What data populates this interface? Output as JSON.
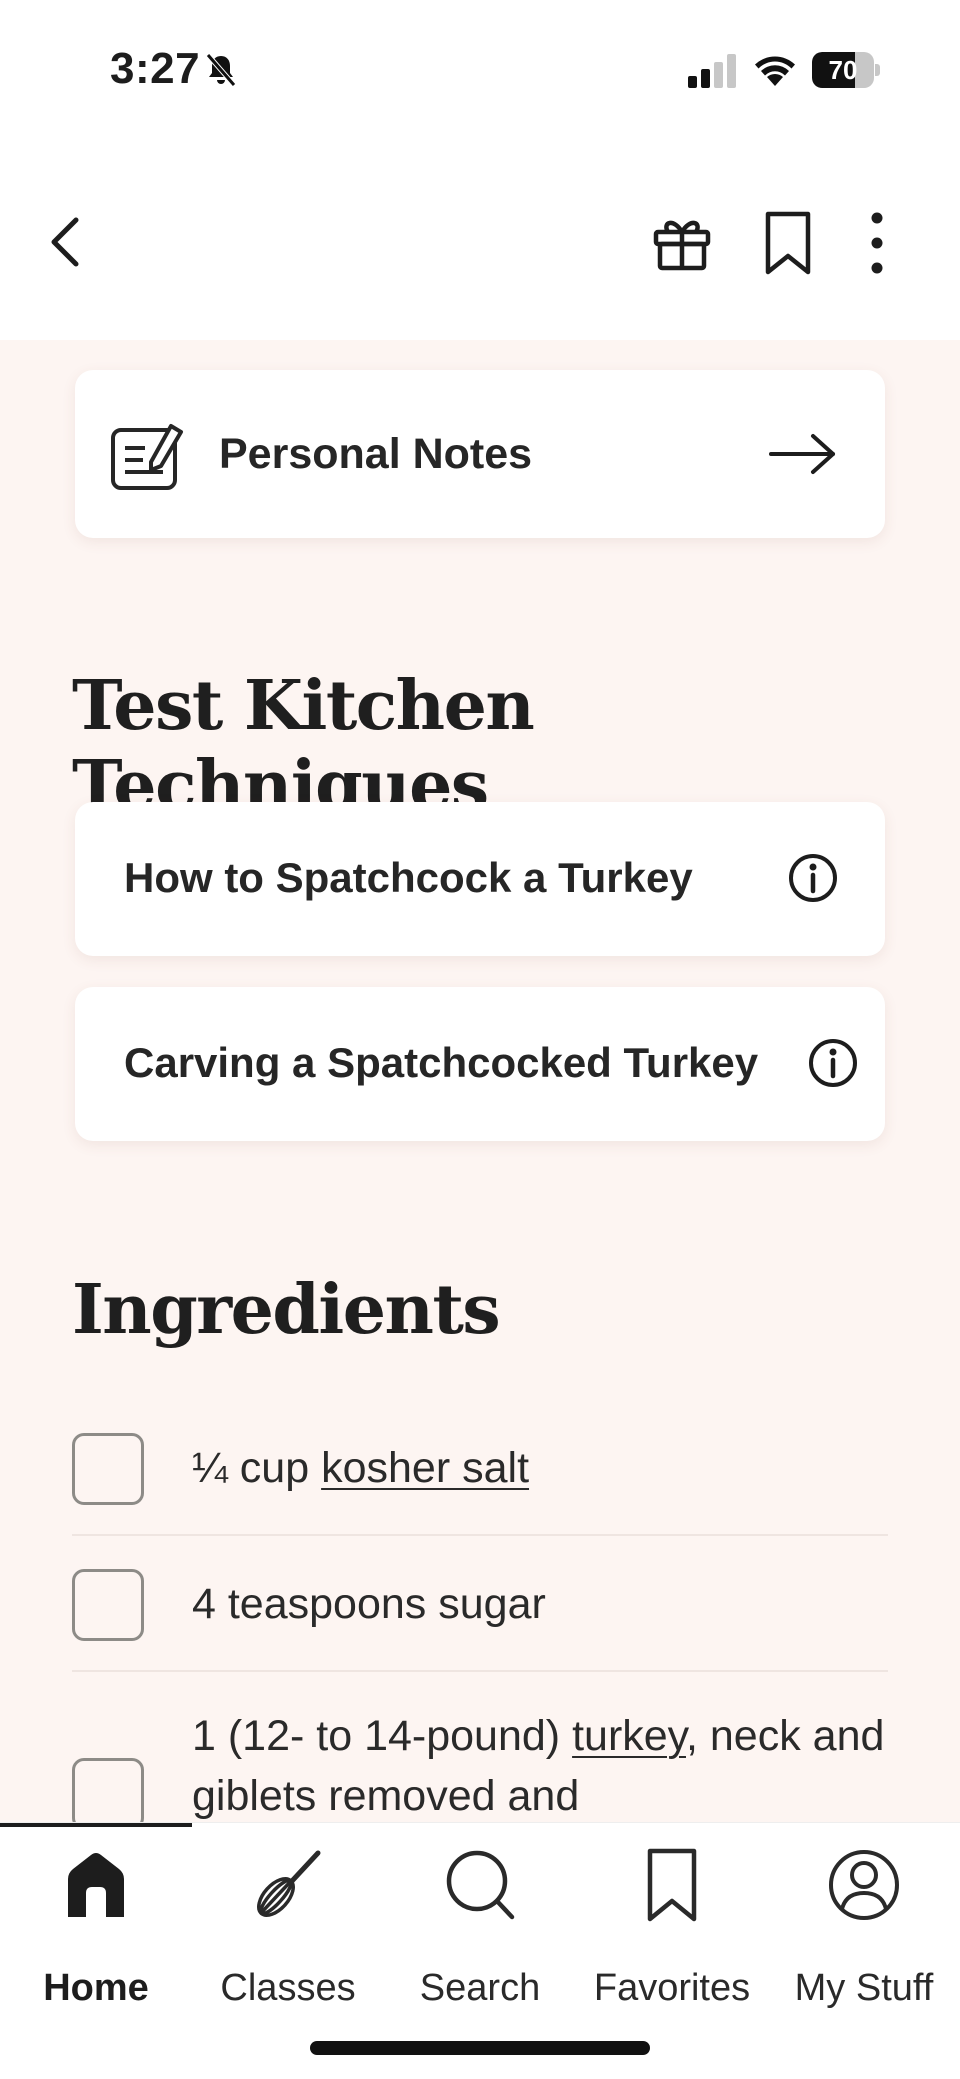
{
  "status_bar": {
    "time": "3:27",
    "battery": "70",
    "battery_level": 0.7
  },
  "nav": {
    "icons": [
      "back-icon",
      "gift-icon",
      "bookmark-icon",
      "more-icon"
    ]
  },
  "personal_notes": {
    "label": "Personal Notes"
  },
  "techniques": {
    "title": "Test Kitchen Techniques",
    "items": [
      {
        "label": "How to Spatchcock a Turkey"
      },
      {
        "label": "Carving a Spatchcocked Turkey"
      }
    ]
  },
  "ingredients": {
    "title": "Ingredients",
    "items": [
      {
        "prefix": "¼ cup ",
        "link": "kosher salt",
        "suffix": ""
      },
      {
        "prefix": "4 teaspoons sugar",
        "link": "",
        "suffix": ""
      },
      {
        "prefix": "1 (12- to 14-pound) ",
        "link": "turkey",
        "suffix": ", neck and giblets removed and"
      }
    ]
  },
  "tab_bar": {
    "tabs": [
      {
        "label": "Home",
        "icon": "home-icon",
        "active": true
      },
      {
        "label": "Classes",
        "icon": "whisk-icon",
        "active": false
      },
      {
        "label": "Search",
        "icon": "search-icon",
        "active": false
      },
      {
        "label": "Favorites",
        "icon": "bookmark-icon",
        "active": false
      },
      {
        "label": "My Stuff",
        "icon": "user-icon",
        "active": false
      }
    ]
  },
  "colors": {
    "background": "#fdf5f2",
    "card": "#ffffff",
    "text": "#1d1d1d",
    "checkbox_border": "#8d8b87"
  }
}
